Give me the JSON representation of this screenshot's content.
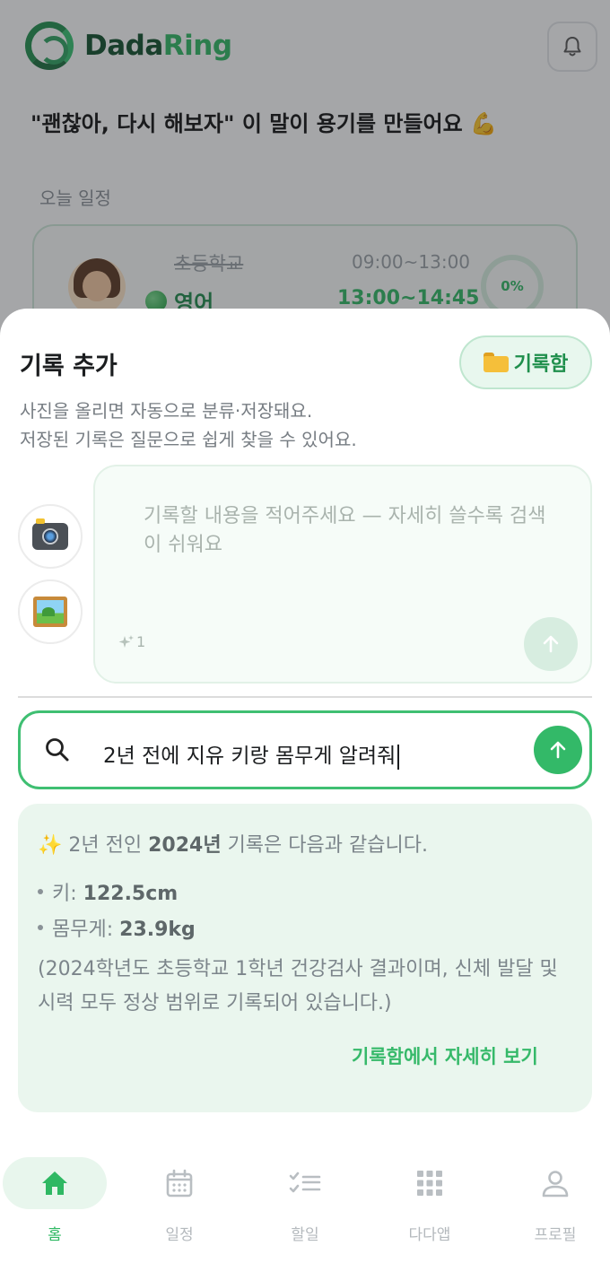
{
  "app": {
    "logo_prefix": "Dada",
    "logo_suffix": "Ring",
    "quote": "\"괜찮아, 다시 해보자\" 이 말이 용기를 만들어요 💪",
    "today_label": "오늘 일정",
    "schedule": {
      "previous_subject": "초등학교",
      "previous_time": "09:00~13:00",
      "current_subject": "영어",
      "current_time": "13:00~14:45",
      "progress": "0%"
    }
  },
  "sheet": {
    "title": "기록 추가",
    "vault_button": "기록함",
    "description_line1": "사진을 올리면 자동으로 분류·저장돼요.",
    "description_line2": "저장된 기록은 질문으로 쉽게 찾을 수 있어요.",
    "note_placeholder": "기록할 내용을 적어주세요 — 자세히 쓸수록 검색이 쉬워요",
    "sparkle_count": "1"
  },
  "search": {
    "query": "2년 전에 지유 키랑 몸무게 알려줘"
  },
  "answer": {
    "intro_prefix": "✨ 2년 전인 ",
    "intro_year": "2024년",
    "intro_suffix": " 기록은 다음과 같습니다.",
    "items": [
      {
        "label": "키: ",
        "value": "122.5cm"
      },
      {
        "label": "몸무게: ",
        "value": "23.9kg"
      }
    ],
    "note": "(2024학년도 초등학교 1학년 건강검사 결과이며, 신체 발달 및 시력 모두 정상 범위로 기록되어 있습니다.)",
    "link": "기록함에서 자세히 보기"
  },
  "nav": {
    "items": [
      {
        "label": "홈",
        "icon": "home-icon",
        "active": true
      },
      {
        "label": "일정",
        "icon": "calendar-icon",
        "active": false
      },
      {
        "label": "할일",
        "icon": "checklist-icon",
        "active": false
      },
      {
        "label": "다다앱",
        "icon": "apps-grid-icon",
        "active": false
      },
      {
        "label": "프로필",
        "icon": "profile-icon",
        "active": false
      }
    ]
  },
  "colors": {
    "accent": "#33b968",
    "brand_dark": "#0f4f2a",
    "answer_bg": "#eaf6ee"
  }
}
